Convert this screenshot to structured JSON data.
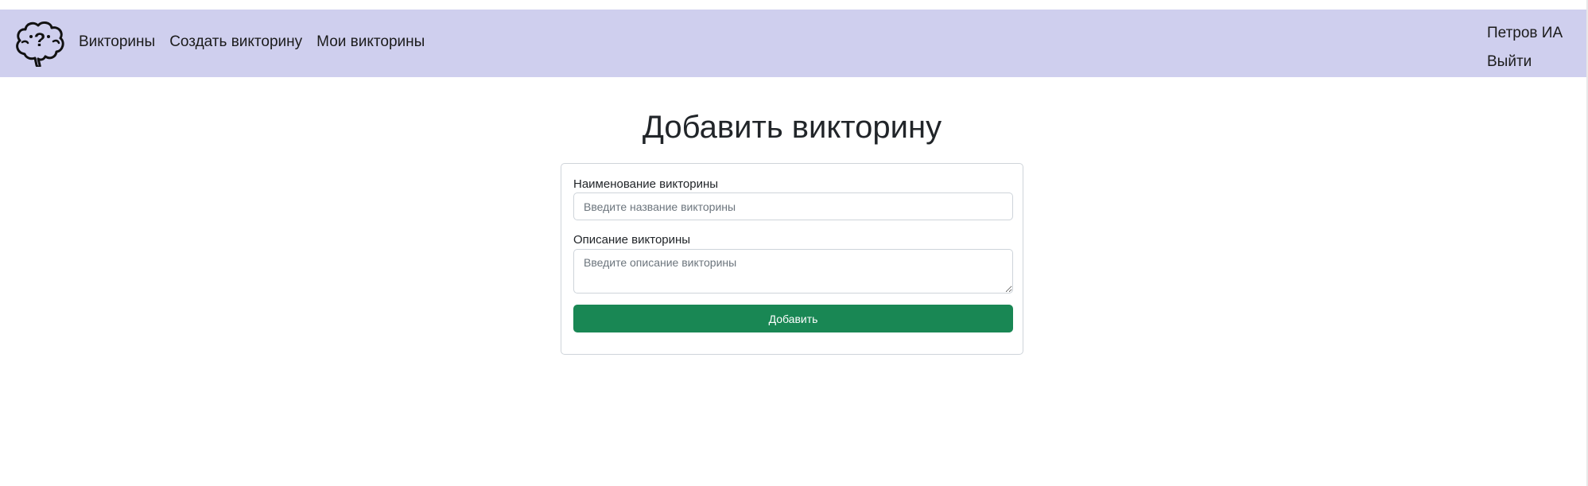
{
  "header": {
    "logo_icon": "brain-question-icon",
    "nav_items": [
      {
        "label": "Викторины"
      },
      {
        "label": "Создать викторину"
      },
      {
        "label": "Мои викторины"
      }
    ],
    "user_name": "Петров ИА",
    "logout_label": "Выйти",
    "background_color": "#cfcfee"
  },
  "main": {
    "title": "Добавить викторину",
    "form": {
      "name_label": "Наименование викторины",
      "name_placeholder": "Введите название викторины",
      "name_value": "",
      "description_label": "Описание викторины",
      "description_placeholder": "Введите описание викторины",
      "description_value": "",
      "submit_label": "Добавить",
      "submit_color": "#198754"
    }
  }
}
